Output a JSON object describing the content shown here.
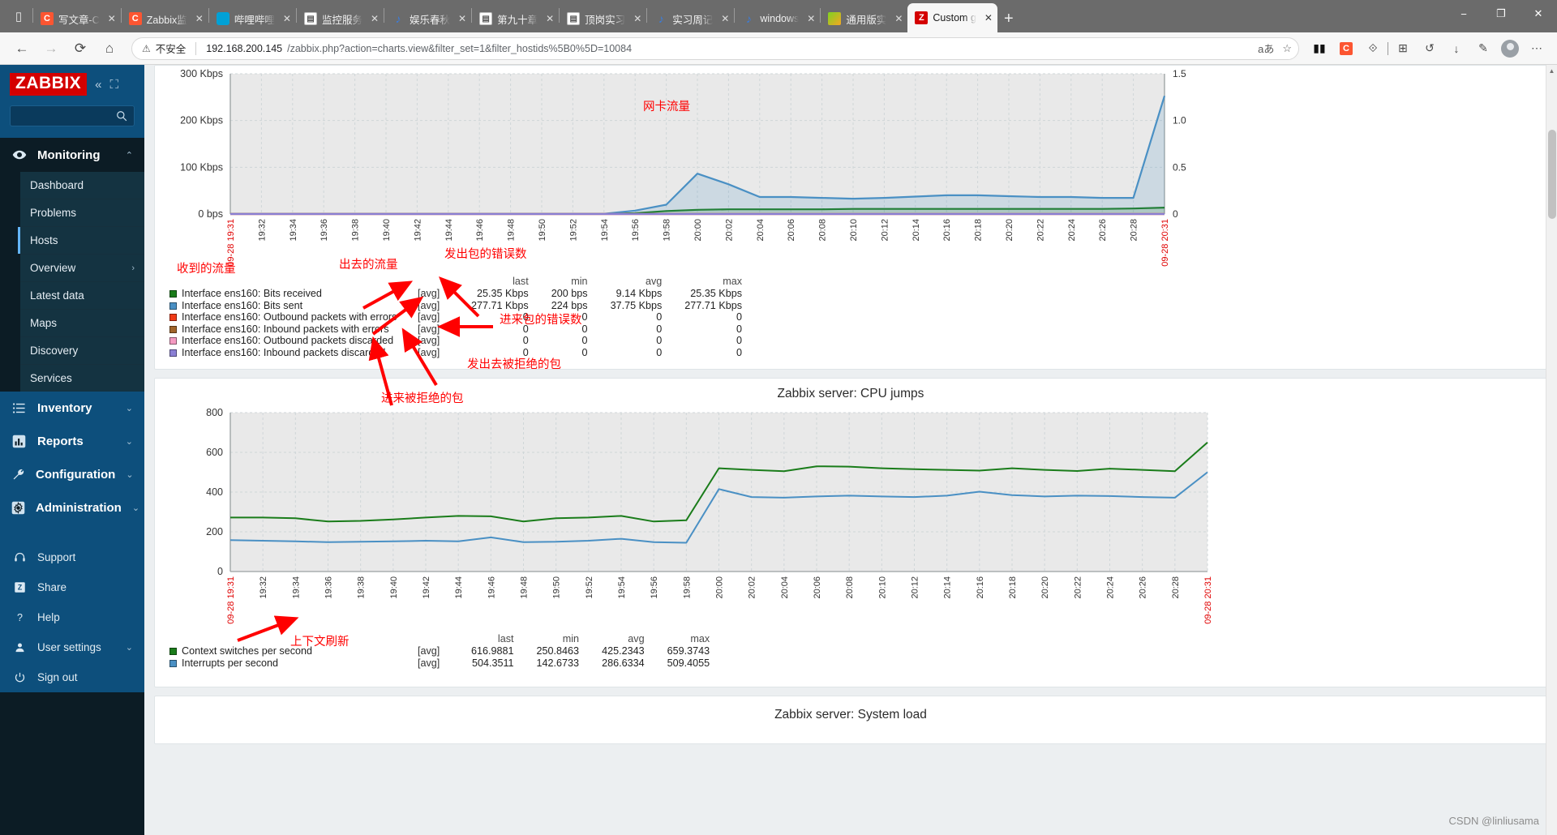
{
  "browser": {
    "tabs": [
      {
        "title": "写文章-C",
        "favicon": "csdn-icon",
        "active": false
      },
      {
        "title": "Zabbix监",
        "favicon": "csdn-icon",
        "active": false
      },
      {
        "title": "哔哩哔哩",
        "favicon": "bilibili-icon",
        "active": false
      },
      {
        "title": "监控服务",
        "favicon": "document-icon",
        "active": false
      },
      {
        "title": "娱乐春秋",
        "favicon": "music-icon",
        "active": false
      },
      {
        "title": "第九十章",
        "favicon": "document-icon",
        "active": false
      },
      {
        "title": "顶岗实习",
        "favicon": "document-icon",
        "active": false
      },
      {
        "title": "实习周记",
        "favicon": "music-icon",
        "active": false
      },
      {
        "title": "windows",
        "favicon": "music-icon",
        "active": false
      },
      {
        "title": "通用版实",
        "favicon": "360-icon",
        "active": false
      },
      {
        "title": "Custom g",
        "favicon": "zabbix-icon",
        "active": true
      }
    ],
    "new_tab_label": "+",
    "close_label": "✕",
    "window_controls": {
      "minimize": "−",
      "maximize": "❐",
      "close": "✕"
    },
    "nav": {
      "back": "←",
      "forward": "→",
      "reload": "⟳",
      "home": "⌂"
    },
    "address": {
      "security_warning": "不安全",
      "warning_glyph": "⚠",
      "host": "192.168.200.145",
      "path": "/zabbix.php?action=charts.view&filter_set=1&filter_hostids%5B0%5D=10084",
      "reader_icon": "aあ",
      "favorite_icon": "☆"
    },
    "toolbar_icons": [
      "collections-icon",
      "csdn-extension-icon",
      "extensions-icon",
      "split-screen-icon",
      "history-icon",
      "downloads-icon",
      "collections-pen-icon",
      "profile-avatar-icon",
      "more-settings-icon"
    ]
  },
  "sidebar": {
    "logo": "ZABBIX",
    "collapse_icon": "«",
    "expand_icon": "⛶",
    "search_placeholder": "",
    "search_icon": "search-icon",
    "groups": [
      {
        "label": "Monitoring",
        "icon": "eye-icon",
        "expanded": true,
        "chevron": "⌃"
      },
      {
        "label": "Inventory",
        "icon": "list-icon",
        "expanded": false,
        "chevron": "⌄"
      },
      {
        "label": "Reports",
        "icon": "bar-chart-icon",
        "expanded": false,
        "chevron": "⌄"
      },
      {
        "label": "Configuration",
        "icon": "wrench-icon",
        "expanded": false,
        "chevron": "⌄"
      },
      {
        "label": "Administration",
        "icon": "gear-icon",
        "expanded": false,
        "chevron": "⌄"
      }
    ],
    "monitoring_items": [
      {
        "label": "Dashboard",
        "active": false,
        "chevron": ""
      },
      {
        "label": "Problems",
        "active": false,
        "chevron": ""
      },
      {
        "label": "Hosts",
        "active": true,
        "chevron": ""
      },
      {
        "label": "Overview",
        "active": false,
        "chevron": "›"
      },
      {
        "label": "Latest data",
        "active": false,
        "chevron": ""
      },
      {
        "label": "Maps",
        "active": false,
        "chevron": ""
      },
      {
        "label": "Discovery",
        "active": false,
        "chevron": ""
      },
      {
        "label": "Services",
        "active": false,
        "chevron": ""
      }
    ],
    "minor_items": [
      {
        "label": "Support",
        "icon": "headset-icon",
        "chevron": ""
      },
      {
        "label": "Share",
        "icon": "zabbix-share-icon",
        "chevron": ""
      },
      {
        "label": "Help",
        "icon": "question-icon",
        "chevron": ""
      },
      {
        "label": "User settings",
        "icon": "user-icon",
        "chevron": "⌄"
      },
      {
        "label": "Sign out",
        "icon": "power-icon",
        "chevron": ""
      }
    ]
  },
  "charts": [
    {
      "title": "",
      "annotation_title": "网卡流量",
      "legend_headers": [
        "last",
        "min",
        "avg",
        "max"
      ],
      "rows": [
        {
          "color": "#1a7c1a",
          "name": "Interface ens160: Bits received",
          "agg": "[avg]",
          "last": "25.35 Kbps",
          "min": "200 bps",
          "avg": "9.14 Kbps",
          "max": "25.35 Kbps"
        },
        {
          "color": "#4a90c4",
          "name": "Interface ens160: Bits sent",
          "agg": "[avg]",
          "last": "277.71 Kbps",
          "min": "224 bps",
          "avg": "37.75 Kbps",
          "max": "277.71 Kbps"
        },
        {
          "color": "#f03a17",
          "name": "Interface ens160: Outbound packets with errors",
          "agg": "[avg]",
          "last": "0",
          "min": "0",
          "avg": "0",
          "max": "0"
        },
        {
          "color": "#a0642a",
          "name": "Interface ens160: Inbound packets with errors",
          "agg": "[avg]",
          "last": "0",
          "min": "0",
          "avg": "0",
          "max": "0"
        },
        {
          "color": "#f49ac1",
          "name": "Interface ens160: Outbound packets discarded",
          "agg": "[avg]",
          "last": "0",
          "min": "0",
          "avg": "0",
          "max": "0"
        },
        {
          "color": "#8a7fd4",
          "name": "Interface ens160: Inbound packets discarded",
          "agg": "[avg]",
          "last": "0",
          "min": "0",
          "avg": "0",
          "max": "0"
        }
      ]
    },
    {
      "title": "Zabbix server: CPU jumps",
      "annotation_title": "",
      "legend_headers": [
        "last",
        "min",
        "avg",
        "max"
      ],
      "rows": [
        {
          "color": "#1a7c1a",
          "name": "Context switches per second",
          "agg": "[avg]",
          "last": "616.9881",
          "min": "250.8463",
          "avg": "425.2343",
          "max": "659.3743"
        },
        {
          "color": "#4a90c4",
          "name": "Interrupts per second",
          "agg": "[avg]",
          "last": "504.3511",
          "min": "142.6733",
          "avg": "286.6334",
          "max": "509.4055"
        }
      ]
    },
    {
      "title": "Zabbix server: System load",
      "annotation_title": "",
      "legend_headers": [],
      "rows": []
    }
  ],
  "annotations": [
    {
      "text": "网卡流量",
      "name": "anno-nic-traffic"
    },
    {
      "text": "收到的流量",
      "name": "anno-received-traffic"
    },
    {
      "text": "出去的流量",
      "name": "anno-sent-traffic"
    },
    {
      "text": "发出包的错误数",
      "name": "anno-outbound-errors"
    },
    {
      "text": "进来包的错误数",
      "name": "anno-inbound-errors"
    },
    {
      "text": "发出去被拒绝的包",
      "name": "anno-outbound-discarded"
    },
    {
      "text": "进来被拒绝的包",
      "name": "anno-inbound-discarded"
    },
    {
      "text": "上下文刷新",
      "name": "anno-context-switch"
    }
  ],
  "chart_data": [
    {
      "type": "line",
      "title": "网卡流量",
      "xlabel": "",
      "ylabel": "",
      "ylim": [
        0,
        330
      ],
      "y2lim": [
        0,
        1.6
      ],
      "grid": true,
      "legend": "bottom",
      "y_ticks": [
        "0 bps",
        "100 Kbps",
        "200 Kbps",
        "300 Kbps"
      ],
      "y2_ticks": [
        "0",
        "0.5",
        "1.0",
        "1.5"
      ],
      "x_start_label": "09-28 19:31",
      "x_end_label": "09-28 20:31",
      "x": [
        "19:31",
        "19:32",
        "19:34",
        "19:36",
        "19:38",
        "19:40",
        "19:42",
        "19:44",
        "19:46",
        "19:48",
        "19:50",
        "19:52",
        "19:54",
        "19:56",
        "19:58",
        "20:00",
        "20:02",
        "20:04",
        "20:06",
        "20:08",
        "20:10",
        "20:12",
        "20:14",
        "20:16",
        "20:18",
        "20:20",
        "20:22",
        "20:24",
        "20:26",
        "20:28",
        "20:31"
      ],
      "series": [
        {
          "name": "Interface ens160: Bits received",
          "color": "#1a7c1a",
          "values": [
            0.2,
            0.2,
            0.2,
            0.2,
            0.2,
            0.2,
            0.2,
            0.2,
            0.2,
            0.2,
            0.2,
            0.2,
            0.2,
            2,
            7,
            10,
            11,
            11,
            11,
            11,
            12,
            12,
            12,
            12,
            12,
            12,
            12,
            12,
            12,
            13,
            15
          ]
        },
        {
          "name": "Interface ens160: Bits sent",
          "color": "#4a90c4",
          "values": [
            0.3,
            0.3,
            0.3,
            0.3,
            0.3,
            0.3,
            0.3,
            0.3,
            0.3,
            0.3,
            0.3,
            0.3,
            0.5,
            8,
            22,
            95,
            70,
            40,
            40,
            38,
            36,
            38,
            41,
            44,
            44,
            42,
            40,
            40,
            38,
            38,
            278
          ]
        },
        {
          "name": "Interface ens160: Outbound packets with errors",
          "color": "#f03a17",
          "values": [
            0,
            0,
            0,
            0,
            0,
            0,
            0,
            0,
            0,
            0,
            0,
            0,
            0,
            0,
            0,
            0,
            0,
            0,
            0,
            0,
            0,
            0,
            0,
            0,
            0,
            0,
            0,
            0,
            0,
            0,
            0
          ]
        },
        {
          "name": "Interface ens160: Inbound packets with errors",
          "color": "#a0642a",
          "values": [
            0,
            0,
            0,
            0,
            0,
            0,
            0,
            0,
            0,
            0,
            0,
            0,
            0,
            0,
            0,
            0,
            0,
            0,
            0,
            0,
            0,
            0,
            0,
            0,
            0,
            0,
            0,
            0,
            0,
            0,
            0
          ]
        },
        {
          "name": "Interface ens160: Outbound packets discarded",
          "color": "#f49ac1",
          "values": [
            0,
            0,
            0,
            0,
            0,
            0,
            0,
            0,
            0,
            0,
            0,
            0,
            0,
            0,
            0,
            0,
            0,
            0,
            0,
            0,
            0,
            0,
            0,
            0,
            0,
            0,
            0,
            0,
            0,
            0,
            0
          ]
        },
        {
          "name": "Interface ens160: Inbound packets discarded",
          "color": "#8a7fd4",
          "values": [
            0,
            0,
            0,
            0,
            0,
            0,
            0,
            0,
            0,
            0,
            0,
            0,
            0,
            0,
            0,
            0,
            0,
            0,
            0,
            0,
            0,
            0,
            0,
            0,
            0,
            0,
            0,
            0,
            0,
            0,
            0
          ]
        }
      ]
    },
    {
      "type": "line",
      "title": "Zabbix server: CPU jumps",
      "xlabel": "",
      "ylabel": "",
      "ylim": [
        0,
        800
      ],
      "grid": true,
      "legend": "bottom",
      "y_ticks": [
        "0",
        "200",
        "400",
        "600",
        "800"
      ],
      "x_start_label": "09-28 19:31",
      "x_end_label": "09-28 20:31",
      "x": [
        "19:31",
        "19:32",
        "19:34",
        "19:36",
        "19:38",
        "19:40",
        "19:42",
        "19:44",
        "19:46",
        "19:48",
        "19:50",
        "19:52",
        "19:54",
        "19:56",
        "19:58",
        "20:00",
        "20:02",
        "20:04",
        "20:06",
        "20:08",
        "20:10",
        "20:12",
        "20:14",
        "20:16",
        "20:18",
        "20:20",
        "20:22",
        "20:24",
        "20:26",
        "20:28",
        "20:31"
      ],
      "series": [
        {
          "name": "Context switches per second",
          "color": "#1a7c1a",
          "values": [
            272,
            272,
            268,
            252,
            255,
            262,
            272,
            280,
            278,
            252,
            268,
            272,
            280,
            252,
            258,
            520,
            512,
            505,
            530,
            528,
            520,
            515,
            512,
            508,
            520,
            512,
            506,
            518,
            512,
            505,
            650
          ]
        },
        {
          "name": "Interrupts per second",
          "color": "#4a90c4",
          "values": [
            158,
            155,
            152,
            148,
            150,
            152,
            155,
            152,
            172,
            148,
            150,
            155,
            165,
            148,
            145,
            415,
            375,
            372,
            378,
            382,
            378,
            375,
            382,
            402,
            385,
            378,
            382,
            380,
            375,
            372,
            500
          ]
        }
      ]
    }
  ],
  "watermark": "CSDN @linliusama"
}
